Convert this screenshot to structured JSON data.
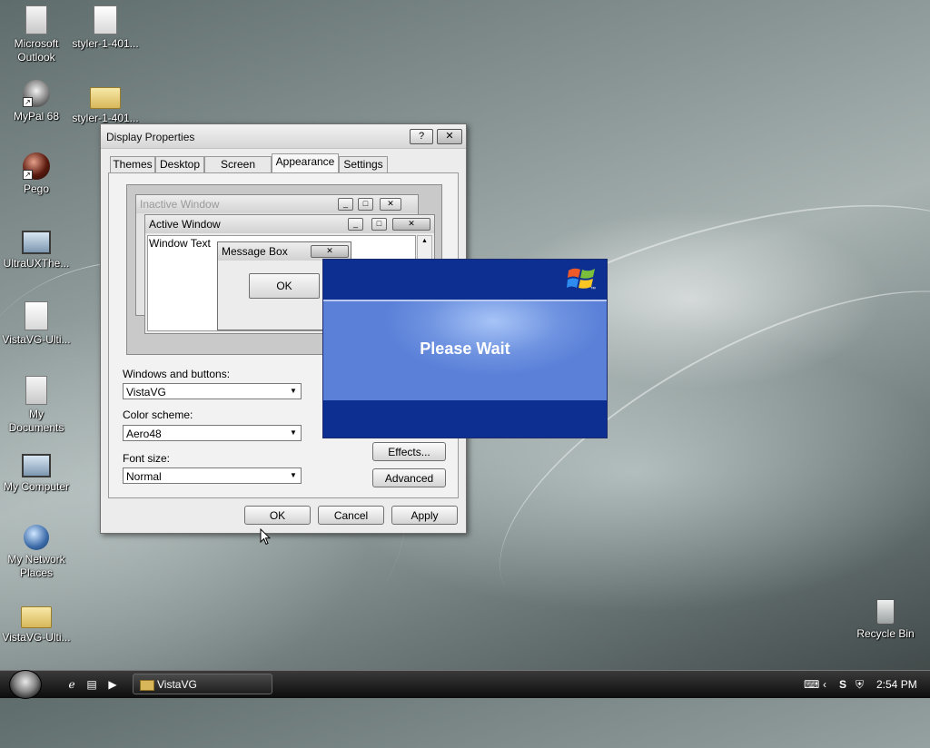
{
  "desktop": {
    "icons": [
      {
        "label": "Microsoft Outlook",
        "icon": "outlook-icon"
      },
      {
        "label": "styler-1-401...",
        "icon": "file-icon"
      },
      {
        "label": "MyPal 68",
        "icon": "mypal-icon"
      },
      {
        "label": "styler-1-401...",
        "icon": "folder-icon"
      },
      {
        "label": "Pego",
        "icon": "pego-icon"
      },
      {
        "label": "UltraUXThe...",
        "icon": "computer-icon"
      },
      {
        "label": "VistaVG-Ulti...",
        "icon": "file-icon"
      },
      {
        "label": "My Documents",
        "icon": "documents-icon"
      },
      {
        "label": "My Computer",
        "icon": "computer-icon"
      },
      {
        "label": "My Network Places",
        "icon": "network-icon"
      },
      {
        "label": "VistaVG-Ulti...",
        "icon": "folder-icon"
      },
      {
        "label": "Recycle Bin",
        "icon": "recycle-bin-icon"
      }
    ]
  },
  "dialog": {
    "title": "Display Properties",
    "help_label": "?",
    "close_label": "✕",
    "tabs": [
      {
        "label": "Themes"
      },
      {
        "label": "Desktop"
      },
      {
        "label": "Screen Saver"
      },
      {
        "label": "Appearance"
      },
      {
        "label": "Settings"
      }
    ],
    "active_tab": "Appearance",
    "preview": {
      "inactive_title": "Inactive Window",
      "active_title": "Active Window",
      "window_text": "Window Text",
      "message_title": "Message Box",
      "message_ok": "OK"
    },
    "windows_buttons_label": "Windows and buttons:",
    "windows_buttons_value": "VistaVG",
    "color_scheme_label": "Color scheme:",
    "color_scheme_value": "Aero48",
    "font_size_label": "Font size:",
    "font_size_value": "Normal",
    "effects_label": "Effects...",
    "advanced_label": "Advanced",
    "ok_label": "OK",
    "cancel_label": "Cancel",
    "apply_label": "Apply"
  },
  "wait_dialog": {
    "message": "Please Wait",
    "brand_mark": "™"
  },
  "taskbar": {
    "task_label": "VistaVG",
    "clock": "2:54 PM",
    "quicklaunch": [
      "ie-icon",
      "folder-icon",
      "media-icon"
    ],
    "tray": [
      "keyboard-icon",
      "chevron-left-icon",
      "s-icon",
      "shield-icon"
    ]
  }
}
